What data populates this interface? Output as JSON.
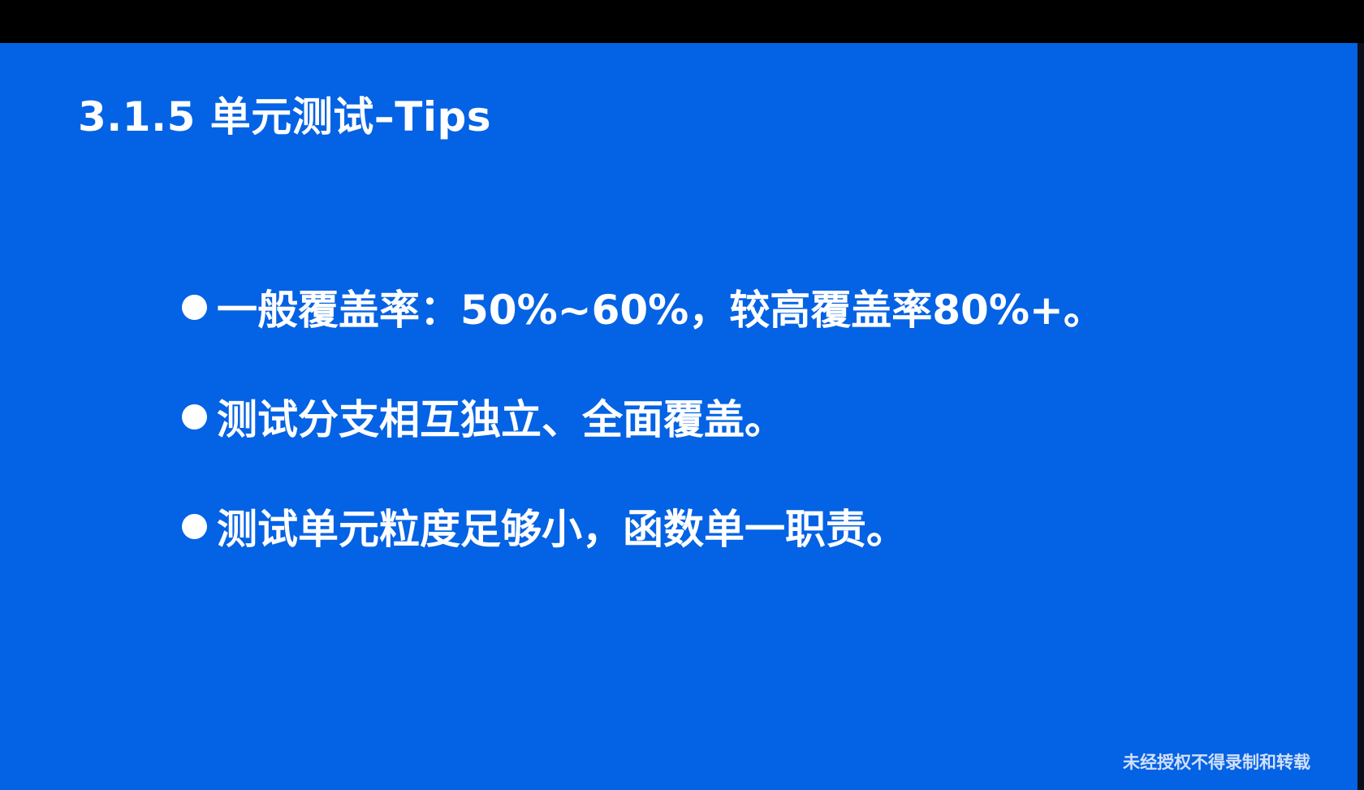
{
  "slide": {
    "title": "3.1.5 单元测试–Tips",
    "bullets": [
      {
        "text": "一般覆盖率：50%~60%，较高覆盖率80%+。"
      },
      {
        "text": "测试分支相互独立、全面覆盖。"
      },
      {
        "text": "测试单元粒度足够小，函数单一职责。"
      }
    ],
    "watermark": "未经授权不得录制和转载"
  },
  "colors": {
    "slide_background": "#0462e4",
    "text": "#ffffff",
    "frame": "#000000"
  }
}
